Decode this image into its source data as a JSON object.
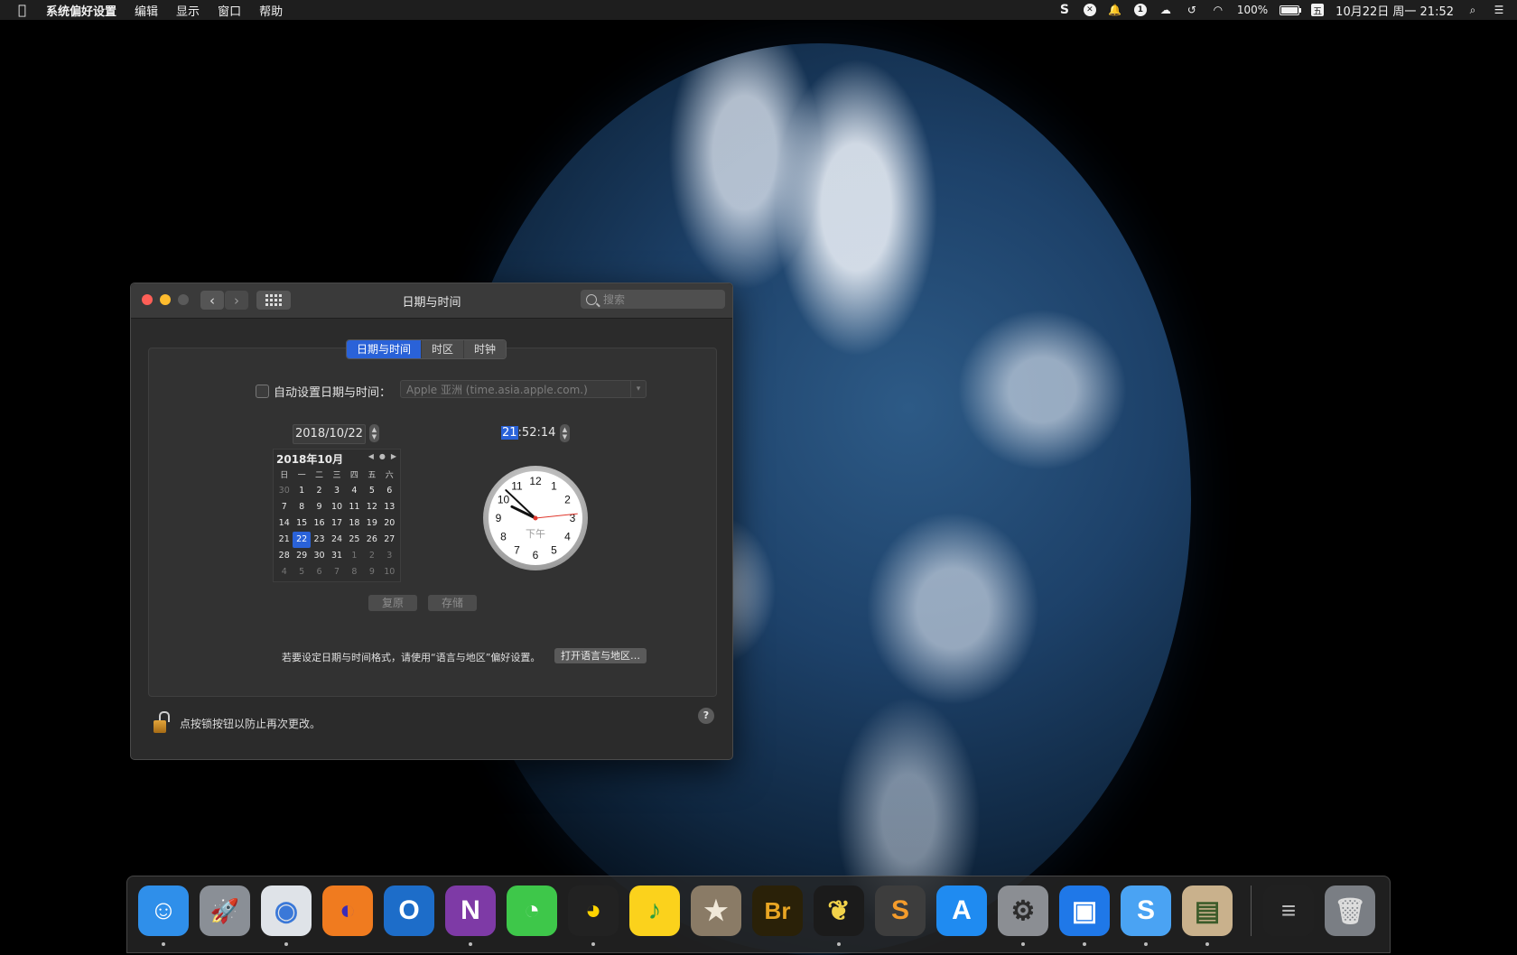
{
  "menubar": {
    "apple_icon": "apple-logo",
    "app_name": "系统偏好设置",
    "menus": [
      "编辑",
      "显示",
      "窗口",
      "帮助"
    ],
    "battery": "100%",
    "ime": "五",
    "datetime": "10月22日 周一  21:52"
  },
  "window": {
    "title": "日期与时间",
    "search_placeholder": "搜索",
    "tabs": [
      "日期与时间",
      "时区",
      "时钟"
    ],
    "active_tab": "日期与时间",
    "auto_label": "自动设置日期与时间：",
    "server": "Apple 亚洲 (time.asia.apple.com.)",
    "date_value": "2018/10/22",
    "time_hour": "21",
    "time_rest": ":52:14",
    "calendar": {
      "month_label": "2018年10月",
      "weekdays": [
        "日",
        "一",
        "二",
        "三",
        "四",
        "五",
        "六"
      ],
      "days": [
        {
          "d": "30",
          "dim": true
        },
        {
          "d": "1"
        },
        {
          "d": "2"
        },
        {
          "d": "3"
        },
        {
          "d": "4"
        },
        {
          "d": "5"
        },
        {
          "d": "6"
        },
        {
          "d": "7"
        },
        {
          "d": "8"
        },
        {
          "d": "9"
        },
        {
          "d": "10"
        },
        {
          "d": "11"
        },
        {
          "d": "12"
        },
        {
          "d": "13"
        },
        {
          "d": "14"
        },
        {
          "d": "15"
        },
        {
          "d": "16"
        },
        {
          "d": "17"
        },
        {
          "d": "18"
        },
        {
          "d": "19"
        },
        {
          "d": "20"
        },
        {
          "d": "21"
        },
        {
          "d": "22",
          "sel": true
        },
        {
          "d": "23"
        },
        {
          "d": "24"
        },
        {
          "d": "25"
        },
        {
          "d": "26"
        },
        {
          "d": "27"
        },
        {
          "d": "28"
        },
        {
          "d": "29"
        },
        {
          "d": "30"
        },
        {
          "d": "31"
        },
        {
          "d": "1",
          "dim": true
        },
        {
          "d": "2",
          "dim": true
        },
        {
          "d": "3",
          "dim": true
        },
        {
          "d": "4",
          "dim": true
        },
        {
          "d": "5",
          "dim": true
        },
        {
          "d": "6",
          "dim": true
        },
        {
          "d": "7",
          "dim": true
        },
        {
          "d": "8",
          "dim": true
        },
        {
          "d": "9",
          "dim": true
        },
        {
          "d": "10",
          "dim": true
        }
      ]
    },
    "clock": {
      "numbers": [
        "12",
        "1",
        "2",
        "3",
        "4",
        "5",
        "6",
        "7",
        "8",
        "9",
        "10",
        "11"
      ],
      "ampm": "下午",
      "hour": 21,
      "minute": 52,
      "second": 14
    },
    "revert_label": "复原",
    "save_label": "存储",
    "format_note": "若要设定日期与时间格式，请使用“语言与地区”偏好设置。",
    "open_region_label": "打开语言与地区…",
    "lock_note": "点按锁按钮以防止再次更改。",
    "help_label": "?"
  },
  "dock": {
    "items": [
      {
        "name": "finder",
        "glyph": "☺",
        "bg": "#2f8fea",
        "fg": "#fff",
        "running": true
      },
      {
        "name": "launchpad",
        "glyph": "🚀",
        "bg": "#8a8f96",
        "fg": "#fff",
        "running": false
      },
      {
        "name": "chrome",
        "glyph": "◉",
        "bg": "#dfe3e8",
        "fg": "#3a78d8",
        "running": true
      },
      {
        "name": "firefox",
        "glyph": "◐",
        "bg": "#f07b1f",
        "fg": "#3b2cb7",
        "running": false
      },
      {
        "name": "outlook",
        "glyph": "O",
        "bg": "#1d6dc9",
        "fg": "#fff",
        "running": false
      },
      {
        "name": "onenote",
        "glyph": "N",
        "bg": "#7e3aa6",
        "fg": "#fff",
        "running": true
      },
      {
        "name": "wechat",
        "glyph": "◔",
        "bg": "#3ec74a",
        "fg": "#fff",
        "running": false
      },
      {
        "name": "qq",
        "glyph": "◕",
        "bg": "#222",
        "fg": "#ffd400",
        "running": true
      },
      {
        "name": "qqmusic",
        "glyph": "♪",
        "bg": "#fbd21c",
        "fg": "#2b9d3e",
        "running": false
      },
      {
        "name": "archive-box",
        "glyph": "★",
        "bg": "#8a7b66",
        "fg": "#f0e8d8",
        "running": false
      },
      {
        "name": "bridge",
        "glyph": "Br",
        "bg": "#2a2108",
        "fg": "#e9a623",
        "running": false
      },
      {
        "name": "tes-butterfly",
        "glyph": "❦",
        "bg": "#1b1b1b",
        "fg": "#f2d34a",
        "running": true
      },
      {
        "name": "sublime",
        "glyph": "S",
        "bg": "#3d3d3d",
        "fg": "#f59c2b",
        "running": false
      },
      {
        "name": "app-store",
        "glyph": "A",
        "bg": "#1f8bf1",
        "fg": "#fff",
        "running": false
      },
      {
        "name": "system-preferences",
        "glyph": "⚙",
        "bg": "#8b8e93",
        "fg": "#2d2d2d",
        "running": true
      },
      {
        "name": "remote-desktop",
        "glyph": "▣",
        "bg": "#1f78e8",
        "fg": "#fff",
        "running": true
      },
      {
        "name": "sogou-input",
        "glyph": "S",
        "bg": "#4aa3f3",
        "fg": "#fff",
        "running": true
      },
      {
        "name": "preview",
        "glyph": "▤",
        "bg": "#c9b18c",
        "fg": "#3c5b2a",
        "running": true
      }
    ],
    "extras": [
      {
        "name": "minimized-window",
        "glyph": "≡",
        "bg": "#202020",
        "fg": "#bbb"
      },
      {
        "name": "trash",
        "glyph": "🗑",
        "bg": "#7a7e84",
        "fg": "#ddd"
      }
    ]
  }
}
